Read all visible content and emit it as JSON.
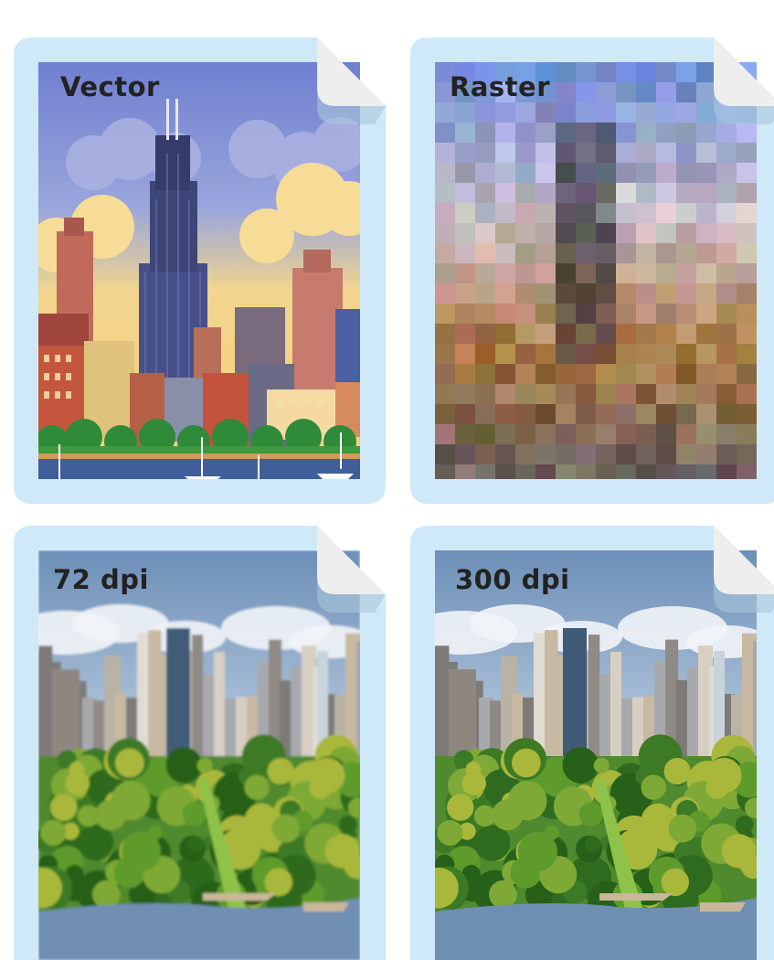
{
  "cards": [
    {
      "label": "Vector",
      "kind": "vector-illustration"
    },
    {
      "label": "Raster",
      "kind": "pixelated-photo"
    },
    {
      "label": "72 dpi",
      "kind": "photo-low-resolution"
    },
    {
      "label": "300 dpi",
      "kind": "photo-high-resolution"
    }
  ],
  "colors": {
    "frame": "#cfe9f8",
    "fold": "#eeeeee",
    "fold_shadow": "#a9c7da",
    "label_text": "#222222"
  },
  "icons": {
    "file": "file-page-icon",
    "folded_corner": "folded-corner-icon"
  }
}
